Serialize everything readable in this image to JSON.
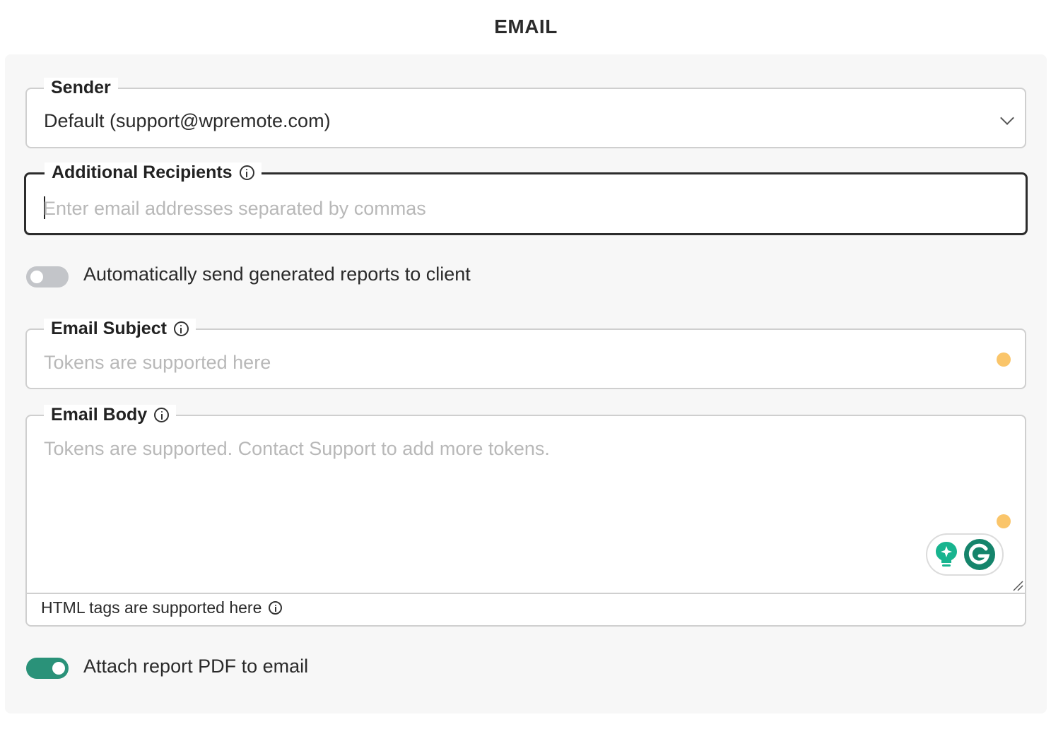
{
  "page": {
    "title": "EMAIL"
  },
  "sender": {
    "label": "Sender",
    "value": "Default (support@wpremote.com)"
  },
  "recipients": {
    "label": "Additional Recipients",
    "placeholder": "Enter email addresses separated by commas"
  },
  "auto_send": {
    "label": "Automatically send generated reports to client",
    "enabled": false
  },
  "subject": {
    "label": "Email Subject",
    "placeholder": "Tokens are supported here"
  },
  "body": {
    "label": "Email Body",
    "placeholder": "Tokens are supported. Contact Support to add more tokens.",
    "html_note": "HTML tags are supported here"
  },
  "attach_pdf": {
    "label": "Attach report PDF to email",
    "enabled": true
  },
  "colors": {
    "toggle_on": "#2a9279",
    "toggle_off": "#c3c5c9",
    "status_dot": "#fac56a",
    "grammarly_green": "#15846b"
  },
  "icons": [
    "info-icon",
    "chevron-down-icon",
    "grammarly-suggestion-icon",
    "grammarly-logo-icon",
    "resize-handle-icon"
  ]
}
